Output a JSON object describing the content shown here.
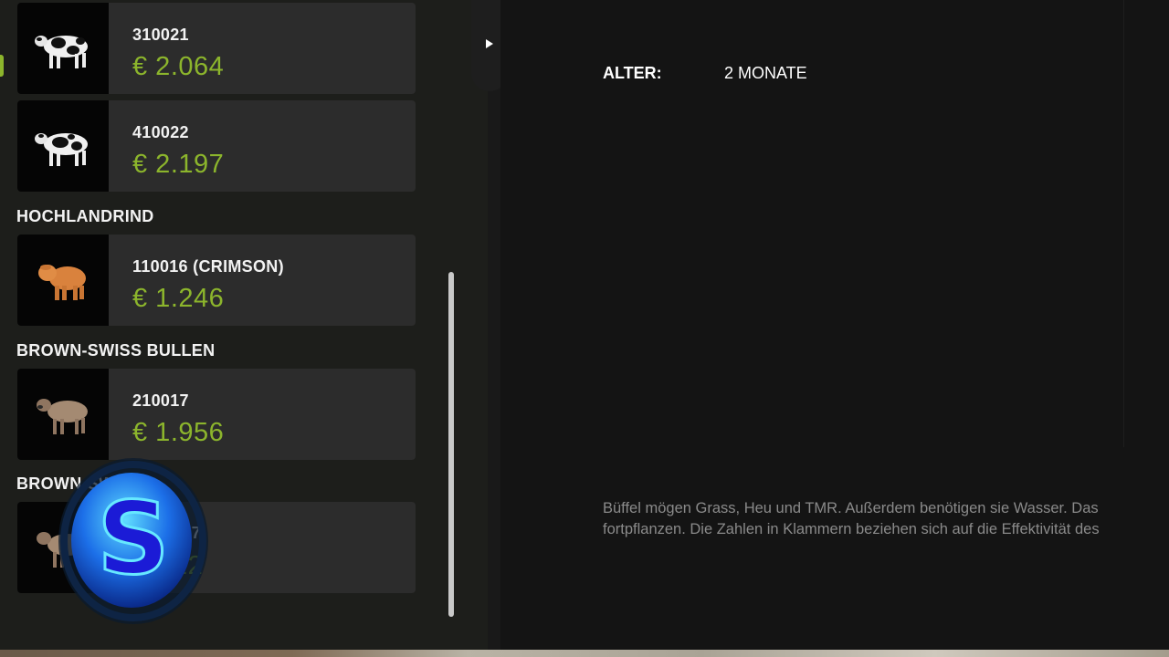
{
  "animals": [
    {
      "id": "310021",
      "price": "€ 2.064",
      "icon": "holstein-cow-icon"
    },
    {
      "id": "410022",
      "price": "€ 2.197",
      "icon": "holstein-cow-icon"
    }
  ],
  "sections": [
    {
      "title": "HOCHLANDRIND",
      "animals": [
        {
          "id": "110016 (CRIMSON)",
          "price": "€ 1.246",
          "icon": "highland-cattle-icon"
        }
      ]
    },
    {
      "title": "BROWN-SWISS BULLEN",
      "animals": [
        {
          "id": "210017",
          "price": "€ 1.956",
          "icon": "brown-swiss-bull-icon"
        }
      ]
    },
    {
      "title": "BROWN-SWI",
      "animals": [
        {
          "id": "017",
          "price": "22",
          "icon": "brown-swiss-cow-icon"
        }
      ]
    }
  ],
  "details": {
    "age_label": "ALTER:",
    "age_value": "2 MONATE",
    "description_line1": "Büffel mögen Grass, Heu und TMR. Außerdem benötigen sie Wasser. Das",
    "description_line2": "fortpflanzen. Die Zahlen in Klammern beziehen sich auf die Effektivität des"
  },
  "colors": {
    "price": "#8cb52c",
    "panel": "#1d1e1b",
    "card": "#2c2c2c"
  },
  "overlay": {
    "logo_letter": "S"
  }
}
